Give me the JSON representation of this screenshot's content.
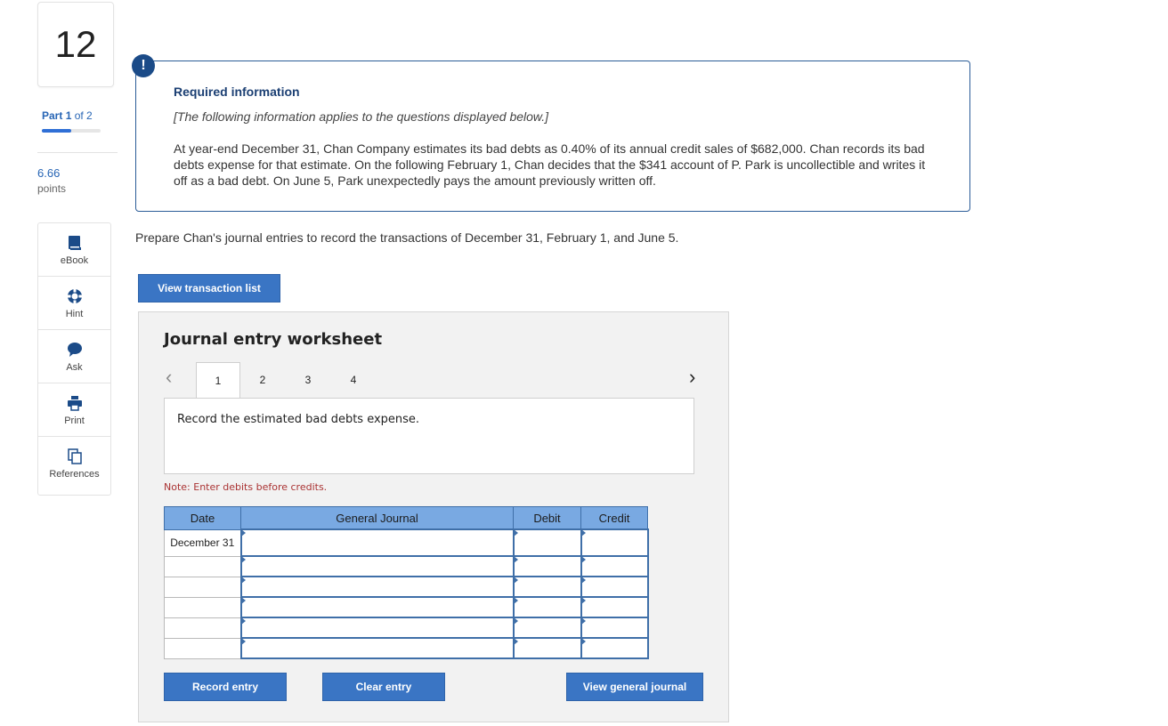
{
  "question": {
    "number": "12",
    "part_label": "Part",
    "part_current": "1",
    "part_of_text": "of 2",
    "part_progress": 0.5,
    "points_value": "6.66",
    "points_label": "points"
  },
  "tools": [
    {
      "label": "eBook",
      "icon": "book-icon"
    },
    {
      "label": "Hint",
      "icon": "lifebuoy-icon"
    },
    {
      "label": "Ask",
      "icon": "chat-bubble-icon"
    },
    {
      "label": "Print",
      "icon": "printer-icon"
    },
    {
      "label": "References",
      "icon": "copy-documents-icon"
    }
  ],
  "info": {
    "icon": "!",
    "title": "Required information",
    "subtitle": "[The following information applies to the questions displayed below.]",
    "body": "At year-end December 31, Chan Company estimates its bad debts as 0.40% of its annual credit sales of $682,000. Chan records its bad debts expense for that estimate. On the following February 1, Chan decides that the $341 account of P. Park is uncollectible and writes it off as a bad debt. On June 5, Park unexpectedly pays the amount previously written off."
  },
  "prompt": "Prepare Chan's journal entries to record the transactions of December 31, February 1, and June 5.",
  "view_transaction_list_label": "View transaction list",
  "worksheet": {
    "title": "Journal entry worksheet",
    "prev_arrow": "‹",
    "next_arrow": "›",
    "tabs": [
      "1",
      "2",
      "3",
      "4"
    ],
    "active_tab": "1",
    "instruction": "Record the estimated bad debts expense.",
    "note": "Note: Enter debits before credits.",
    "columns": {
      "date": "Date",
      "general_journal": "General Journal",
      "debit": "Debit",
      "credit": "Credit"
    },
    "rows": [
      {
        "date": "December 31",
        "account": "",
        "debit": "",
        "credit": ""
      },
      {
        "date": "",
        "account": "",
        "debit": "",
        "credit": ""
      },
      {
        "date": "",
        "account": "",
        "debit": "",
        "credit": ""
      },
      {
        "date": "",
        "account": "",
        "debit": "",
        "credit": ""
      },
      {
        "date": "",
        "account": "",
        "debit": "",
        "credit": ""
      },
      {
        "date": "",
        "account": "",
        "debit": "",
        "credit": ""
      }
    ],
    "record_entry_label": "Record entry",
    "clear_entry_label": "Clear entry",
    "view_general_journal_label": "View general journal"
  },
  "colors": {
    "button_blue": "#3a75c4",
    "header_blue": "#79a9e2",
    "alert_navy": "#1b4b88",
    "note_red": "#aa3333"
  }
}
